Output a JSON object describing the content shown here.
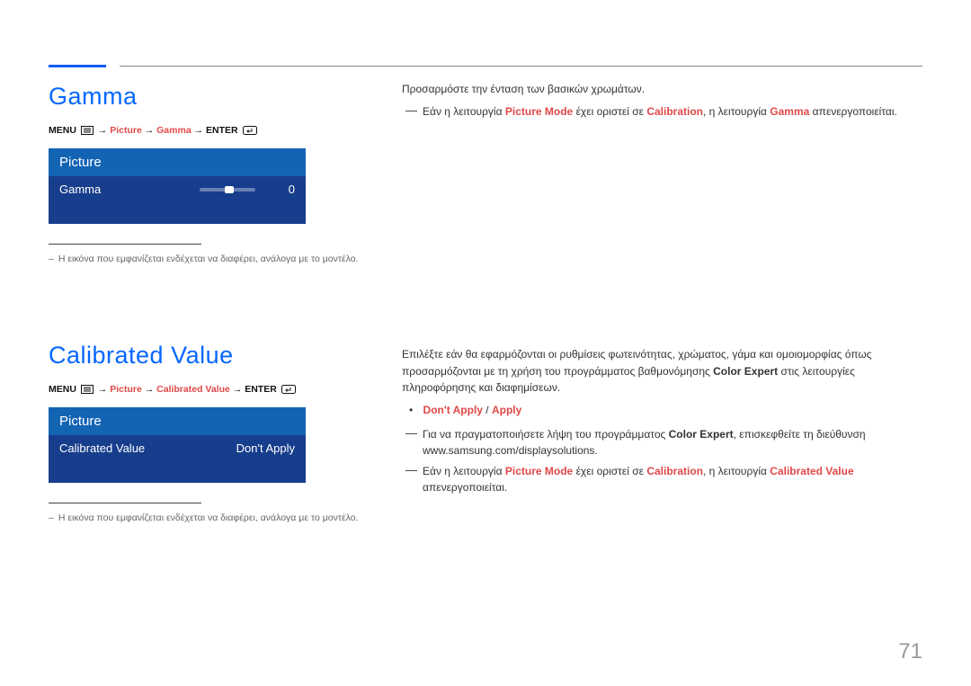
{
  "page_number": "71",
  "arrow": "→",
  "section1": {
    "title": "Gamma",
    "path": {
      "menu": "MENU",
      "p1": "Picture",
      "p2": "Gamma",
      "enter": "ENTER"
    },
    "panel": {
      "header": "Picture",
      "row_label": "Gamma",
      "row_value": "0"
    },
    "note": "Η εικόνα που εμφανίζεται ενδέχεται να διαφέρει, ανάλογα με το μοντέλο.",
    "body": {
      "p1": "Προσαρμόστε την ένταση των βασικών χρωμάτων.",
      "dash_pre": "Εάν η λειτουργία ",
      "dash_mode": "Picture Mode",
      "dash_mid": " έχει οριστεί σε ",
      "dash_cal": "Calibration",
      "dash_mid2": ", η λειτουργία ",
      "dash_gamma": "Gamma",
      "dash_post": " απενεργοποιείται."
    }
  },
  "section2": {
    "title": "Calibrated Value",
    "path": {
      "menu": "MENU",
      "p1": "Picture",
      "p2": "Calibrated Value",
      "enter": "ENTER"
    },
    "panel": {
      "header": "Picture",
      "row_label": "Calibrated Value",
      "row_value": "Don't Apply"
    },
    "note": "Η εικόνα που εμφανίζεται ενδέχεται να διαφέρει, ανάλογα με το μοντέλο.",
    "body": {
      "p1_a": "Επιλέξτε εάν θα εφαρμόζονται οι ρυθμίσεις φωτεινότητας, χρώματος, γάμα και ομοιομορφίας όπως προσαρμόζονται με τη χρήση του προγράμματος βαθμονόμησης ",
      "p1_b": "Color Expert",
      "p1_c": " στις λειτουργίες πληροφόρησης και διαφημίσεων.",
      "bullet_a": "Don't Apply",
      "bullet_sep": " / ",
      "bullet_b": "Apply",
      "dash1_a": "Για να πραγματοποιήσετε λήψη του προγράμματος ",
      "dash1_b": "Color Expert",
      "dash1_c": ", επισκεφθείτε τη διεύθυνση www.samsung.com/displaysolutions.",
      "dash2_pre": "Εάν η λειτουργία ",
      "dash2_mode": "Picture Mode",
      "dash2_mid": " έχει οριστεί σε ",
      "dash2_cal": "Calibration",
      "dash2_mid2": ", η λειτουργία ",
      "dash2_cv": "Calibrated Value",
      "dash2_post": " απενεργοποιείται."
    }
  }
}
